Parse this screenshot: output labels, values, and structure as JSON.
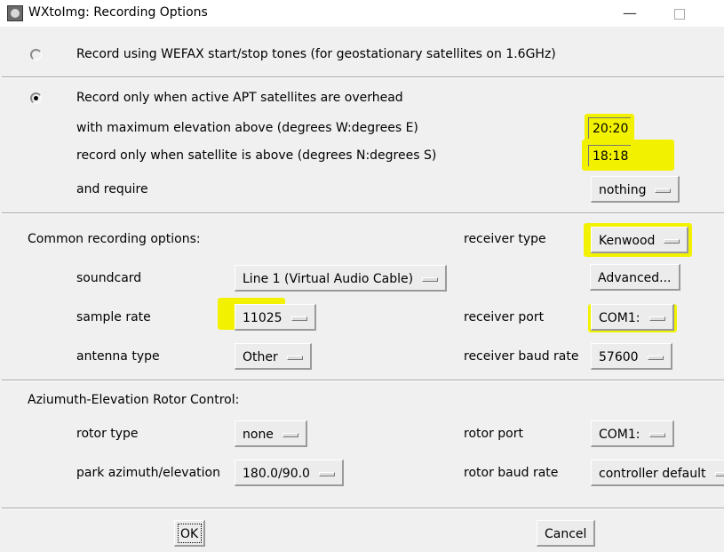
{
  "window": {
    "title": "WXtoImg: Recording Options",
    "icon": "satellite-dish-icon"
  },
  "wefax": {
    "label": "Record using WEFAX start/stop tones (for geostationary satellites on 1.6GHz)",
    "selected": false
  },
  "apt": {
    "label": "Record only when active APT satellites are overhead",
    "selected": true,
    "max_elevation_label": "with maximum elevation above (degrees W:degrees E)",
    "max_elevation_value": "20:20",
    "above_label": "record only when satellite is above (degrees N:degrees S)",
    "above_value": "18:18",
    "require_label": "and require",
    "require_value": "nothing"
  },
  "common": {
    "header": "Common recording options:",
    "soundcard_label": "soundcard",
    "soundcard_value": "Line 1 (Virtual Audio Cable)",
    "sample_rate_label": "sample rate",
    "sample_rate_value": "11025",
    "antenna_type_label": "antenna type",
    "antenna_type_value": "Other",
    "receiver_type_label": "receiver type",
    "receiver_type_value": "Kenwood",
    "advanced_label": "Advanced...",
    "receiver_port_label": "receiver port",
    "receiver_port_value": "COM1:",
    "receiver_baud_label": "receiver baud rate",
    "receiver_baud_value": "57600"
  },
  "rotor": {
    "header": "Aziumuth-Elevation Rotor Control:",
    "rotor_type_label": "rotor type",
    "rotor_type_value": "none",
    "park_label": "park azimuth/elevation",
    "park_value": "180.0/90.0",
    "rotor_port_label": "rotor port",
    "rotor_port_value": "COM1:",
    "rotor_baud_label": "rotor baud rate",
    "rotor_baud_value": "controller default"
  },
  "footer": {
    "ok_label": "OK",
    "cancel_label": "Cancel"
  },
  "colors": {
    "highlight": "#f2f200",
    "background": "#f0f0f0"
  }
}
